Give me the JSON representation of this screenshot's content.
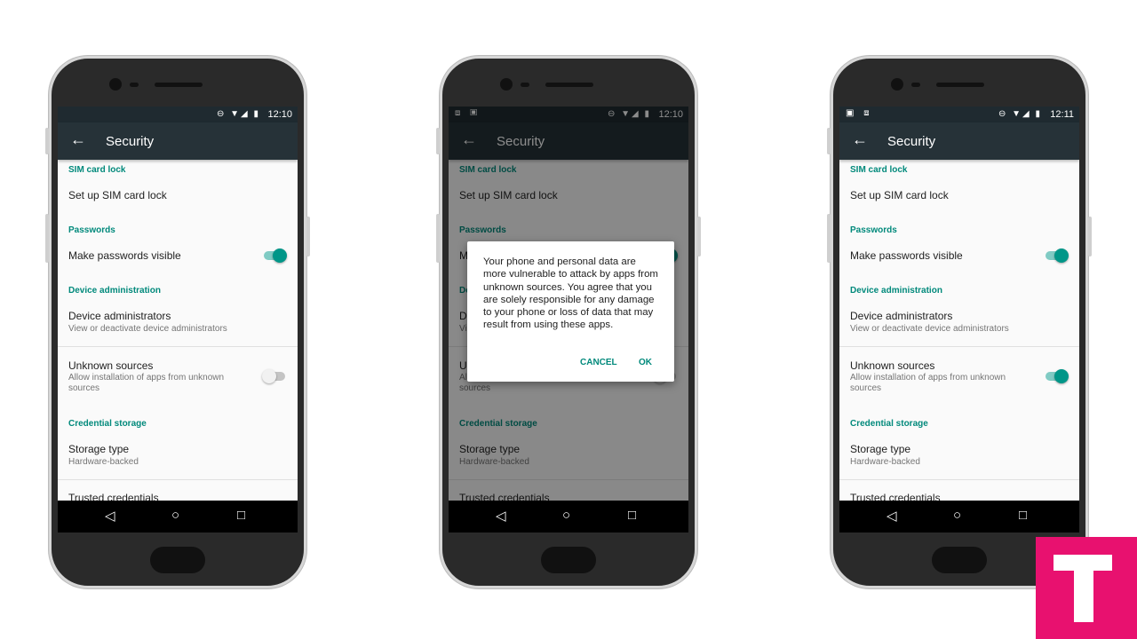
{
  "accent_color": "#009688",
  "toolbar_color": "#263238",
  "phones": [
    {
      "status_left_icons": "",
      "time": "12:10",
      "title": "Security",
      "unknown_sources_enabled": false,
      "dialog": false
    },
    {
      "status_left_icons": "⧈ ▣",
      "time": "12:10",
      "title": "Security",
      "unknown_sources_enabled": false,
      "dialog": true
    },
    {
      "status_left_icons": "▣ ⧈",
      "time": "12:11",
      "title": "Security",
      "unknown_sources_enabled": true,
      "dialog": false
    }
  ],
  "status_icons": "⊖ ▼◢ ▮",
  "settings": {
    "sim_header": "SIM card lock",
    "sim_item": "Set up SIM card lock",
    "passwords_header": "Passwords",
    "passwords_item": "Make passwords visible",
    "passwords_visible": true,
    "device_admin_header": "Device administration",
    "device_admins": "Device administrators",
    "device_admins_sub": "View or deactivate device administrators",
    "unknown_sources": "Unknown sources",
    "unknown_sources_sub": "Allow installation of apps from unknown sources",
    "credential_header": "Credential storage",
    "storage_type": "Storage type",
    "storage_type_sub": "Hardware-backed",
    "trusted_credentials": "Trusted credentials"
  },
  "dialog": {
    "message": "Your phone and personal data are more vulnerable to attack by apps from unknown sources. You agree that you are solely responsible for any damage to your phone or loss of data that may result from using these apps.",
    "cancel": "CANCEL",
    "ok": "OK"
  },
  "nav": {
    "back_icon": "◁",
    "home_icon": "○",
    "recents_icon": "□"
  },
  "logo": {
    "letter": "T",
    "color": "#e8116f"
  }
}
